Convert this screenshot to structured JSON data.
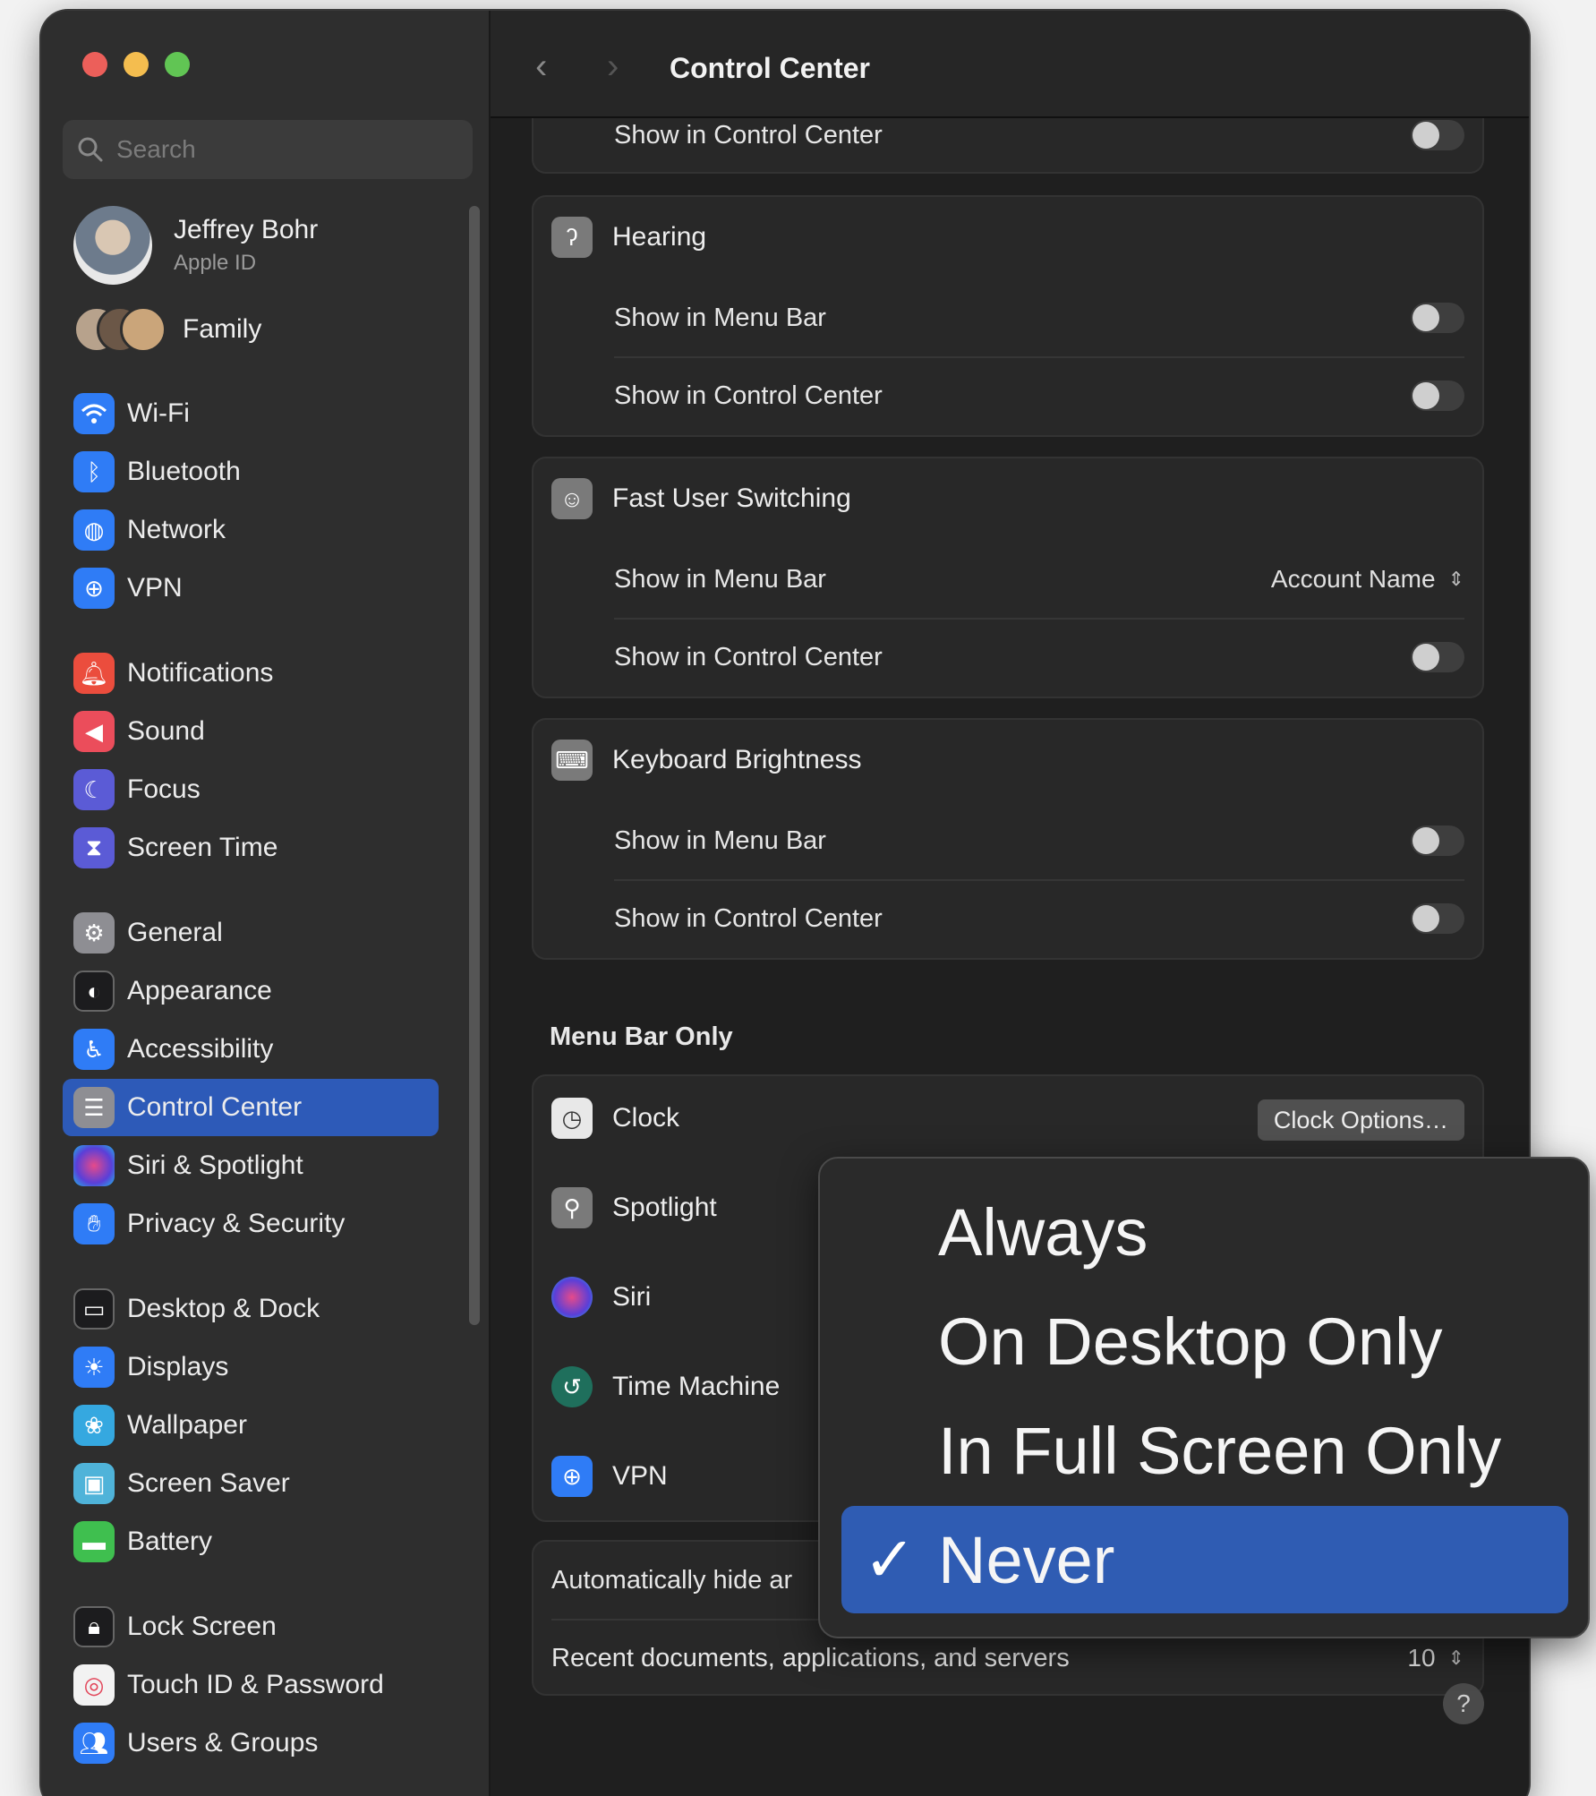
{
  "window": {
    "title": "Control Center"
  },
  "sidebar": {
    "search_placeholder": "Search",
    "user": {
      "name": "Jeffrey Bohr",
      "subtitle": "Apple ID"
    },
    "family_label": "Family",
    "items": [
      {
        "label": "Wi-Fi",
        "icon": "wifi-icon",
        "color": "#2f7cf6"
      },
      {
        "label": "Bluetooth",
        "icon": "bluetooth-icon",
        "color": "#2f7cf6"
      },
      {
        "label": "Network",
        "icon": "globe-icon",
        "color": "#2f7cf6"
      },
      {
        "label": "VPN",
        "icon": "vpn-globe-icon",
        "color": "#2f7cf6"
      },
      {
        "label": "Notifications",
        "icon": "bell-icon",
        "color": "#eb4d3d"
      },
      {
        "label": "Sound",
        "icon": "speaker-icon",
        "color": "#eb4d5b"
      },
      {
        "label": "Focus",
        "icon": "moon-icon",
        "color": "#5b5bd6"
      },
      {
        "label": "Screen Time",
        "icon": "hourglass-icon",
        "color": "#5b5bd6"
      },
      {
        "label": "General",
        "icon": "gear-icon",
        "color": "#8e8e93"
      },
      {
        "label": "Appearance",
        "icon": "appearance-icon",
        "color": "#1c1c1e"
      },
      {
        "label": "Accessibility",
        "icon": "accessibility-icon",
        "color": "#2f7cf6"
      },
      {
        "label": "Control Center",
        "icon": "control-center-icon",
        "color": "#8e8e93"
      },
      {
        "label": "Siri & Spotlight",
        "icon": "siri-icon",
        "color": "#b04fd8"
      },
      {
        "label": "Privacy & Security",
        "icon": "hand-icon",
        "color": "#2f7cf6"
      },
      {
        "label": "Desktop & Dock",
        "icon": "dock-icon",
        "color": "#1c1c1e"
      },
      {
        "label": "Displays",
        "icon": "sun-icon",
        "color": "#2f7cf6"
      },
      {
        "label": "Wallpaper",
        "icon": "flower-icon",
        "color": "#35a8e0"
      },
      {
        "label": "Screen Saver",
        "icon": "screensaver-icon",
        "color": "#4fb3d9"
      },
      {
        "label": "Battery",
        "icon": "battery-icon",
        "color": "#3fbf4f"
      },
      {
        "label": "Lock Screen",
        "icon": "lock-icon",
        "color": "#1c1c1e"
      },
      {
        "label": "Touch ID & Password",
        "icon": "fingerprint-icon",
        "color": "#f2f2f2"
      },
      {
        "label": "Users & Groups",
        "icon": "users-icon",
        "color": "#2f7cf6"
      }
    ],
    "active_item": "Control Center"
  },
  "main": {
    "partial_row_top": "Show in Control Center",
    "cards": [
      {
        "title": "Hearing",
        "icon": "ear-icon",
        "rows": [
          {
            "label": "Show in Menu Bar",
            "control": "toggle",
            "value": "off"
          },
          {
            "label": "Show in Control Center",
            "control": "toggle",
            "value": "off"
          }
        ]
      },
      {
        "title": "Fast User Switching",
        "icon": "user-circle-icon",
        "rows": [
          {
            "label": "Show in Menu Bar",
            "control": "select",
            "value": "Account Name"
          },
          {
            "label": "Show in Control Center",
            "control": "toggle",
            "value": "off"
          }
        ]
      },
      {
        "title": "Keyboard Brightness",
        "icon": "keyboard-icon",
        "rows": [
          {
            "label": "Show in Menu Bar",
            "control": "toggle",
            "value": "off"
          },
          {
            "label": "Show in Control Center",
            "control": "toggle",
            "value": "off"
          }
        ]
      }
    ],
    "menu_bar_only": {
      "title": "Menu Bar Only",
      "items": [
        {
          "label": "Clock",
          "icon": "clock-icon",
          "button": "Clock Options…"
        },
        {
          "label": "Spotlight",
          "icon": "magnifier-icon"
        },
        {
          "label": "Siri",
          "icon": "siri-orb-icon"
        },
        {
          "label": "Time Machine",
          "icon": "time-machine-icon"
        },
        {
          "label": "VPN",
          "icon": "vpn-globe-icon"
        }
      ]
    },
    "bottom_rows": {
      "autohide_label": "Automatically hide ar",
      "recent_label": "Recent documents, applications, and servers",
      "recent_value": "10"
    },
    "help_label": "?"
  },
  "popup_menu": {
    "options": [
      "Always",
      "On Desktop Only",
      "In Full Screen Only",
      "Never"
    ],
    "selected": "Never",
    "check_mark": "✓"
  },
  "colors": {
    "accent": "#2d5ab8",
    "window_bg": "#262626",
    "sidebar_bg": "#2e2e2e"
  }
}
